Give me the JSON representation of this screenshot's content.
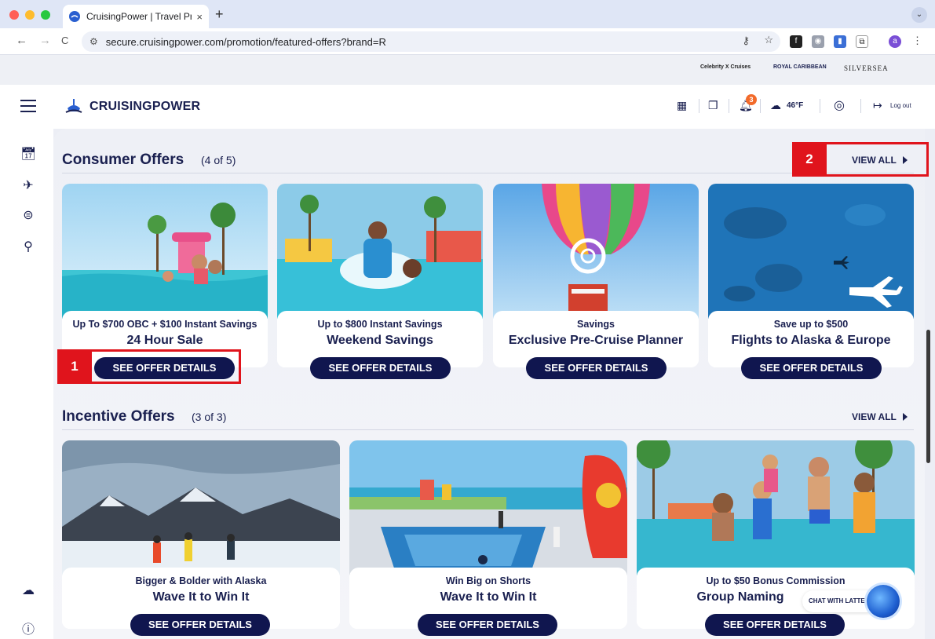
{
  "browser": {
    "tab_title": "CruisingPower | Travel Profes",
    "tab_close": "×",
    "new_tab": "+",
    "url": "secure.cruisingpower.com/promotion/featured-offers?brand=R",
    "profile_initial": "a",
    "back": "←",
    "forward": "→",
    "reload": "C"
  },
  "brands": {
    "celebrity": "Celebrity X Cruises",
    "royal": "ROYAL CARIBBEAN",
    "silversea": "SILVERSEA"
  },
  "header": {
    "logo_text": "CRUISINGPOWER",
    "notification_count": "3",
    "temperature": "46°F",
    "logout_label": "Log out"
  },
  "consumer": {
    "title": "Consumer Offers",
    "count": "(4 of 5)",
    "view_all": "VIEW ALL",
    "cards": [
      {
        "sub": "Up To $700 OBC + $100 Instant Savings",
        "title": "24 Hour Sale",
        "button": "SEE OFFER DETAILS"
      },
      {
        "sub": "Up to $800 Instant Savings",
        "title": "Weekend Savings",
        "button": "SEE OFFER DETAILS"
      },
      {
        "sub": "Savings",
        "title": "Exclusive Pre-Cruise Planner",
        "button": "SEE OFFER DETAILS"
      },
      {
        "sub": "Save up to $500",
        "title": "Flights to Alaska & Europe",
        "button": "SEE OFFER DETAILS"
      }
    ]
  },
  "incentive": {
    "title": "Incentive Offers",
    "count": "(3 of 3)",
    "view_all": "VIEW ALL",
    "cards": [
      {
        "sub": "Bigger & Bolder with Alaska",
        "title": "Wave It to Win It",
        "button": "SEE OFFER DETAILS"
      },
      {
        "sub": "Win Big on Shorts",
        "title": "Wave It to Win It",
        "button": "SEE OFFER DETAILS"
      },
      {
        "sub": "Up to $50 Bonus Commission",
        "title": "Group Naming",
        "button": "SEE OFFER DETAILS"
      }
    ]
  },
  "annotations": {
    "one": "1",
    "two": "2"
  },
  "chat": {
    "label": "CHAT WITH LATTE"
  },
  "colors": {
    "navy": "#10164f",
    "accent_red": "#e0141c",
    "badge_orange": "#f26a2a"
  }
}
